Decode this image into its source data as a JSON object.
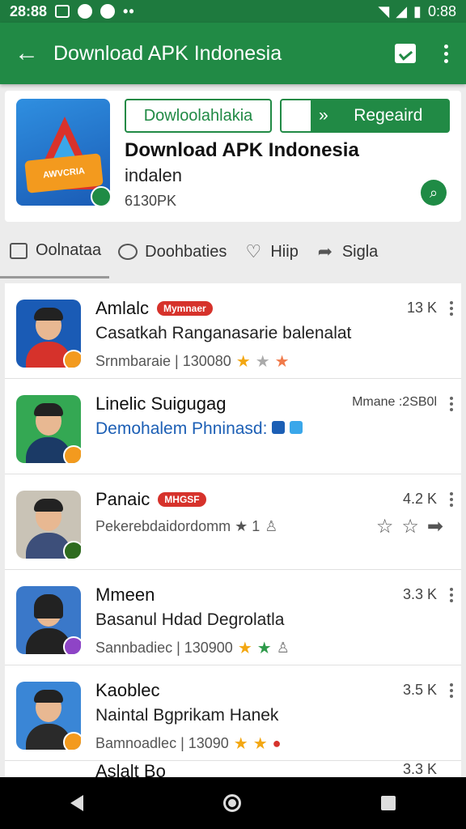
{
  "status_bar": {
    "time_left": "28:88",
    "time_right": "0:88",
    "dots": "••"
  },
  "app_bar": {
    "back_icon": "arrow-left-icon",
    "title": "Download APK Indonesia"
  },
  "header": {
    "icon_tag": "AWVCRIA",
    "install_button": "Dowloolahlakia",
    "open_button": "Regeaird",
    "title": "Download APK Indonesia",
    "developer": "indalen",
    "size": "6130PK"
  },
  "tabs": [
    {
      "label": "Oolnataa",
      "icon": "square-icon"
    },
    {
      "label": "Doohbaties",
      "icon": "chat-bubble-icon"
    },
    {
      "label": "Hiip",
      "icon": "heart-icon"
    },
    {
      "label": "Sigla",
      "icon": "share-icon"
    }
  ],
  "reviews": [
    {
      "name": "Amlalc",
      "pill": "Mymnaer",
      "desc": "Casatkah Ranganasarie balenalat",
      "meta": "Srnmbaraie | 130080",
      "count": "13 K",
      "rating": 2.5,
      "avatar_bg": "#1a5bb5",
      "body_color": "#d6322b",
      "overlay_color": "#f39a1e"
    },
    {
      "name": "Linelic Suigugag",
      "pill": "",
      "desc": "Demohalem Phninasd:",
      "meta": "",
      "count": "Mmane :2SB0l",
      "rating": 0,
      "avatar_bg": "#34a853",
      "body_color": "#1b3a66",
      "overlay_color": "#f39a1e"
    },
    {
      "name": "Panaic",
      "pill": "MHGSF",
      "desc": "",
      "meta": "Pekerebdaidordomm ★ 1",
      "count": "4.2 K",
      "rating": 0,
      "avatar_bg": "#c9c3b6",
      "body_color": "#3d4f7a",
      "overlay_color": "#2e6b1f"
    },
    {
      "name": "Mmeen",
      "pill": "",
      "desc": "Basanul Hdad Degrolatla",
      "meta": "Sannbadiec | 130900",
      "count": "3.3 K",
      "rating": 2,
      "avatar_bg": "#3a78c9",
      "body_color": "#222222",
      "overlay_color": "#8e44c6"
    },
    {
      "name": "Kaoblec",
      "pill": "",
      "desc": "Naintal Bgprikam Hanek",
      "meta": "Bamnoadlec | 13090",
      "count": "3.5 K",
      "rating": 2,
      "avatar_bg": "#3a86d6",
      "body_color": "#2a2a2a",
      "overlay_color": "#f39a1e"
    }
  ],
  "partial_row": {
    "name": "Aslalt Bo",
    "count": "3.3 K"
  }
}
